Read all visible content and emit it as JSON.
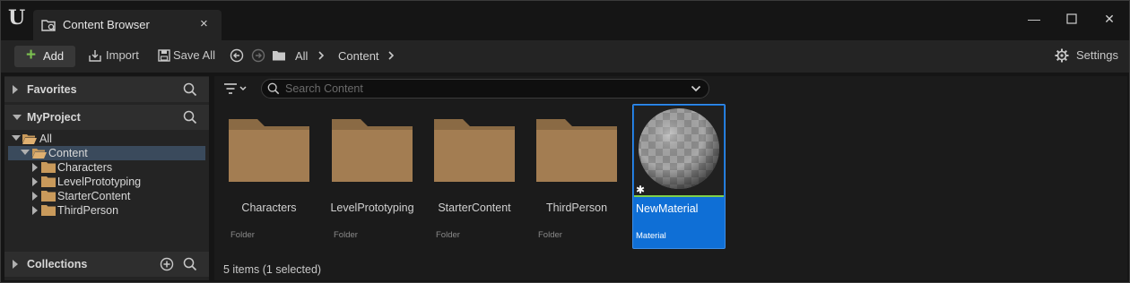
{
  "window": {
    "tab_title": "Content Browser",
    "tab_close": "×",
    "controls": {
      "minimize": "—",
      "maximize": "☐",
      "close": "✕"
    }
  },
  "toolbar": {
    "add_label": "Add",
    "import_label": "Import",
    "save_all_label": "Save All",
    "breadcrumb": [
      "All",
      "Content"
    ],
    "settings_label": "Settings"
  },
  "sidebar": {
    "favorites_label": "Favorites",
    "project_label": "MyProject",
    "tree": [
      {
        "label": "All",
        "expanded": true,
        "level": 0,
        "selected": false
      },
      {
        "label": "Content",
        "expanded": true,
        "level": 1,
        "selected": true
      },
      {
        "label": "Characters",
        "expanded": false,
        "level": 2,
        "selected": false
      },
      {
        "label": "LevelPrototyping",
        "expanded": false,
        "level": 2,
        "selected": false
      },
      {
        "label": "StarterContent",
        "expanded": false,
        "level": 2,
        "selected": false
      },
      {
        "label": "ThirdPerson",
        "expanded": false,
        "level": 2,
        "selected": false
      }
    ],
    "collections_label": "Collections"
  },
  "main": {
    "search_placeholder": "Search Content",
    "assets": [
      {
        "name": "Characters",
        "type": "Folder"
      },
      {
        "name": "LevelPrototyping",
        "type": "Folder"
      },
      {
        "name": "StarterContent",
        "type": "Folder"
      },
      {
        "name": "ThirdPerson",
        "type": "Folder"
      },
      {
        "name": "NewMaterial",
        "type": "Material",
        "selected": true
      }
    ],
    "status": "5 items (1 selected)"
  },
  "colors": {
    "folder": "#a37d52",
    "selection": "#0f6fd6",
    "accent_green": "#7cc150",
    "tree_selected": "#3a4a5c"
  }
}
